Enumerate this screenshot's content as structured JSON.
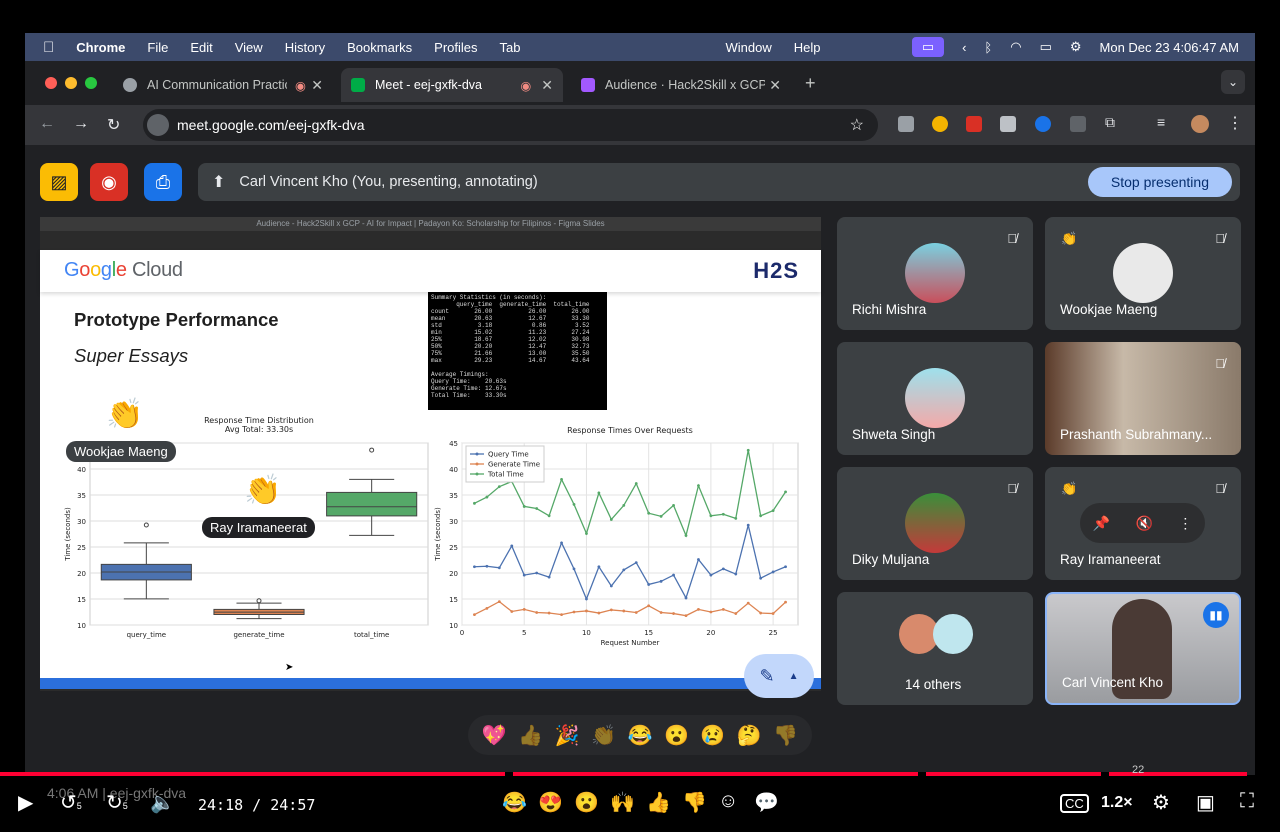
{
  "menubar": {
    "app": "Chrome",
    "items": [
      "File",
      "Edit",
      "View",
      "History",
      "Bookmarks",
      "Profiles",
      "Tab"
    ],
    "right_items": [
      "Window",
      "Help"
    ],
    "datetime": "Mon Dec 23  4:06:47 AM"
  },
  "tabs": [
    {
      "label": "AI Communication Practic",
      "active": false
    },
    {
      "label": "Meet - eej-gxfk-dva",
      "active": true
    },
    {
      "label": "Audience · Hack2Skill x GCP",
      "active": false
    }
  ],
  "address": {
    "url": "meet.google.com/eej-gxfk-dva"
  },
  "meet": {
    "presenting_text": "Carl Vincent Kho (You, presenting, annotating)",
    "stop_presenting": "Stop presenting",
    "slide_window_title": "Audience - Hack2Skill x GCP - AI for Impact | Padayon Ko: Scholarship for Filipinos - Figma Slides",
    "slide": {
      "logo": "Google Cloud",
      "logo2": "H2S",
      "title": "Prototype Performance",
      "subtitle": "Super Essays",
      "terminal": "Summary Statistics (in seconds):\n       query_time  generate_time  total_time\ncount       26.00          26.00       26.00\nmean        20.63          12.67       33.30\nstd          3.18           0.86        3.52\nmin         15.02          11.23       27.24\n25%         18.67          12.02       30.98\n50%         20.20          12.47       32.73\n75%         21.66          13.00       35.50\nmax         29.23          14.67       43.64\n\nAverage Timings:\nQuery Time:    20.63s\nGenerate Time: 12.67s\nTotal Time:    33.30s"
    },
    "name_tags": [
      "Wookjae Maeng",
      "Ray Iramaneerat"
    ],
    "participants": [
      {
        "name": "Richi Mishra",
        "muted": true,
        "hand": false
      },
      {
        "name": "Wookjae Maeng",
        "muted": true,
        "hand": true
      },
      {
        "name": "Shweta Singh",
        "muted": false,
        "hand": false
      },
      {
        "name": "Prashanth Subrahmany...",
        "muted": true,
        "hand": false
      },
      {
        "name": "Diky Muljana",
        "muted": true,
        "hand": false
      },
      {
        "name": "Ray Iramaneerat",
        "muted": true,
        "hand": true
      },
      {
        "name": "14 others",
        "muted": false,
        "hand": false
      },
      {
        "name": "Carl Vincent Kho",
        "muted": false,
        "hand": false,
        "speaking": true
      }
    ],
    "reactions": [
      "💖",
      "👍",
      "🎉",
      "👏",
      "😂",
      "😮",
      "😢",
      "🤔",
      "👎"
    ],
    "meeting_time": "4:06 AM",
    "meeting_code": "eej-gxfk-dva"
  },
  "player": {
    "time": "24:18 / 24:57",
    "speed": "1.2×",
    "skip_back": "5",
    "skip_fwd": "5",
    "progress": 0.974,
    "emojis": [
      "😂",
      "😍",
      "😮",
      "🙌",
      "👍",
      "👎"
    ],
    "badge": "22"
  },
  "chart_data": [
    {
      "type": "box",
      "title": "Response Time Distribution",
      "subtitle": "Avg Total: 33.30s",
      "ylabel": "Time (seconds)",
      "xlabel": "",
      "ylim": [
        10,
        45
      ],
      "yticks": [
        10,
        15,
        20,
        25,
        30,
        35,
        40,
        45
      ],
      "categories": [
        "query_time",
        "generate_time",
        "total_time"
      ],
      "boxes": [
        {
          "name": "query_time",
          "min": 15.02,
          "q1": 18.67,
          "median": 20.2,
          "q3": 21.66,
          "whisker_high": 25.8,
          "outliers": [
            29.23
          ],
          "color": "#4c72b0"
        },
        {
          "name": "generate_time",
          "min": 11.23,
          "q1": 12.02,
          "median": 12.47,
          "q3": 13.0,
          "whisker_high": 14.2,
          "outliers": [
            14.67
          ],
          "color": "#dd8452"
        },
        {
          "name": "total_time",
          "min": 27.24,
          "q1": 30.98,
          "median": 32.73,
          "q3": 35.5,
          "whisker_high": 38.0,
          "outliers": [
            43.64
          ],
          "color": "#55a868"
        }
      ]
    },
    {
      "type": "line",
      "title": "Response Times Over Requests",
      "xlabel": "Request Number",
      "ylabel": "Time (seconds)",
      "xlim": [
        0,
        27
      ],
      "ylim": [
        10,
        45
      ],
      "xticks": [
        0,
        5,
        10,
        15,
        20,
        25
      ],
      "yticks": [
        10,
        15,
        20,
        25,
        30,
        35,
        40,
        45
      ],
      "legend_position": "top-left",
      "x": [
        1,
        2,
        3,
        4,
        5,
        6,
        7,
        8,
        9,
        10,
        11,
        12,
        13,
        14,
        15,
        16,
        17,
        18,
        19,
        20,
        21,
        22,
        23,
        24,
        25,
        26
      ],
      "series": [
        {
          "name": "Query Time",
          "color": "#4c72b0",
          "values": [
            21.2,
            21.3,
            21.0,
            25.2,
            19.6,
            20.0,
            19.2,
            25.8,
            20.8,
            15.0,
            21.2,
            17.5,
            20.6,
            22.0,
            17.8,
            18.4,
            19.6,
            15.2,
            22.6,
            19.6,
            20.8,
            19.8,
            29.2,
            19.0,
            20.2,
            21.2
          ]
        },
        {
          "name": "Generate Time",
          "color": "#dd8452",
          "values": [
            12.0,
            13.2,
            14.5,
            12.6,
            13.0,
            12.4,
            12.3,
            12.0,
            12.5,
            12.7,
            12.3,
            12.9,
            12.7,
            12.4,
            13.7,
            12.4,
            12.2,
            11.8,
            13.0,
            12.5,
            13.0,
            12.2,
            14.2,
            12.3,
            12.2,
            14.4
          ]
        },
        {
          "name": "Total Time",
          "color": "#55a868",
          "values": [
            33.4,
            34.6,
            36.6,
            37.6,
            32.8,
            32.4,
            31.0,
            38.0,
            33.2,
            27.6,
            35.4,
            30.3,
            33.0,
            37.2,
            31.5,
            30.9,
            33.0,
            27.2,
            36.8,
            31.0,
            31.3,
            30.5,
            43.6,
            31.0,
            32.0,
            35.6
          ]
        }
      ]
    }
  ]
}
